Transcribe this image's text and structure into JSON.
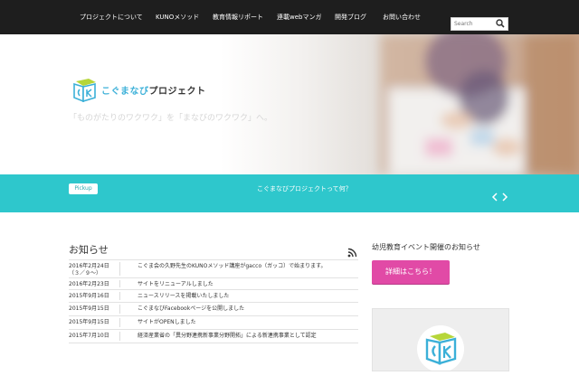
{
  "nav": {
    "items": [
      {
        "label": "プロジェクトについて"
      },
      {
        "label": "KUNOメソッド"
      },
      {
        "label": "教育情報リポート"
      },
      {
        "label": "連載webマンガ"
      },
      {
        "label": "開発ブログ"
      },
      {
        "label": "お問い合わせ"
      }
    ],
    "search_placeholder": "Search"
  },
  "hero": {
    "logo_text_a": "こぐまなび",
    "logo_text_b": "プロジェクト",
    "tagline": "「ものがたりのワクワク」を「まなびのワクワク」へ。"
  },
  "pickup": {
    "badge": "Pickup",
    "link": "こぐまなびプロジェクトって何？"
  },
  "news": {
    "title": "お知らせ",
    "items": [
      {
        "date": "2016年2月24日",
        "date2": "（３／９～）",
        "text": "こぐま会の久野先生のKUNOメソッド講座がgacco（ガッコ）で始まります。"
      },
      {
        "date": "2016年2月23日",
        "text": "サイトをリニューアルしました"
      },
      {
        "date": "2015年9月16日",
        "text": "ニュースリリースを掲載いたしました"
      },
      {
        "date": "2015年9月15日",
        "text": "こぐまなびFacebookページを公開しました"
      },
      {
        "date": "2015年9月15日",
        "text": "サイトがOPENしました"
      },
      {
        "date": "2015年7月10日",
        "text": "経済産業省の「異分野連携新事業分野開拓」による新連携事業として認定"
      }
    ]
  },
  "sidebar": {
    "title": "幼児教育イベント開催のお知らせ",
    "cta_label": "詳細はこちら！"
  },
  "colors": {
    "nav_bg": "#1e1e1e",
    "band": "#2ec7cc",
    "cta": "#e14aa6",
    "logo_blue": "#3bb0d8",
    "logo_lime": "#b6d63a"
  }
}
